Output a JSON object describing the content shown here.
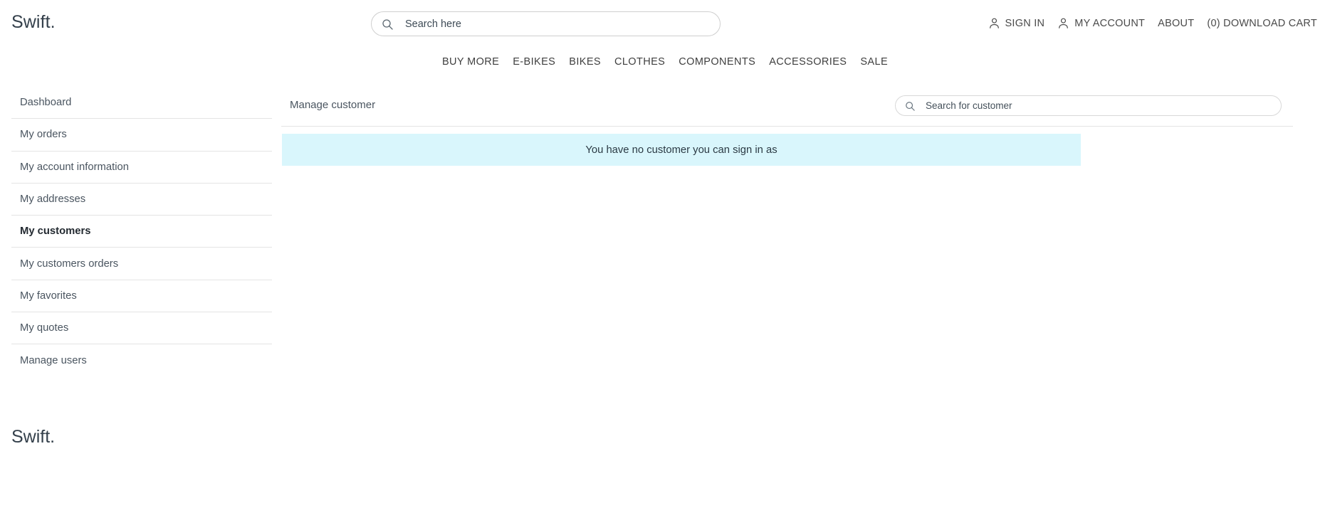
{
  "header": {
    "brand": "Swift.",
    "search": {
      "placeholder": "Search here",
      "value": "",
      "icon": "search-icon"
    },
    "top_links": [
      {
        "label": "SIGN IN",
        "icon": "user-icon"
      },
      {
        "label": "MY ACCOUNT",
        "icon": "user-icon"
      },
      {
        "label": "ABOUT",
        "icon": ""
      },
      {
        "label": "(0) DOWNLOAD CART",
        "icon": ""
      }
    ]
  },
  "mainnav": {
    "items": [
      {
        "label": "BUY MORE"
      },
      {
        "label": "E-BIKES"
      },
      {
        "label": "BIKES"
      },
      {
        "label": "CLOTHES"
      },
      {
        "label": "COMPONENTS"
      },
      {
        "label": "ACCESSORIES"
      },
      {
        "label": "SALE"
      }
    ]
  },
  "sidebar": {
    "items": [
      {
        "label": "Dashboard",
        "active": false
      },
      {
        "label": "My orders",
        "active": false
      },
      {
        "label": "My account information",
        "active": false
      },
      {
        "label": "My addresses",
        "active": false
      },
      {
        "label": "My customers",
        "active": true
      },
      {
        "label": "My customers orders",
        "active": false
      },
      {
        "label": "My favorites",
        "active": false
      },
      {
        "label": "My quotes",
        "active": false
      },
      {
        "label": "Manage users",
        "active": false
      }
    ]
  },
  "main": {
    "title": "Manage customer",
    "customer_search": {
      "placeholder": "Search for customer",
      "value": "",
      "icon": "search-icon"
    },
    "notice": {
      "message": "You have no customer you can sign in as",
      "background": "#d9f6fc"
    }
  },
  "footer": {
    "brand": "Swift."
  },
  "colors": {
    "text": "#4a5560",
    "heading": "#34404b",
    "border": "#e4e4e4",
    "notice_bg": "#d9f6fc"
  }
}
